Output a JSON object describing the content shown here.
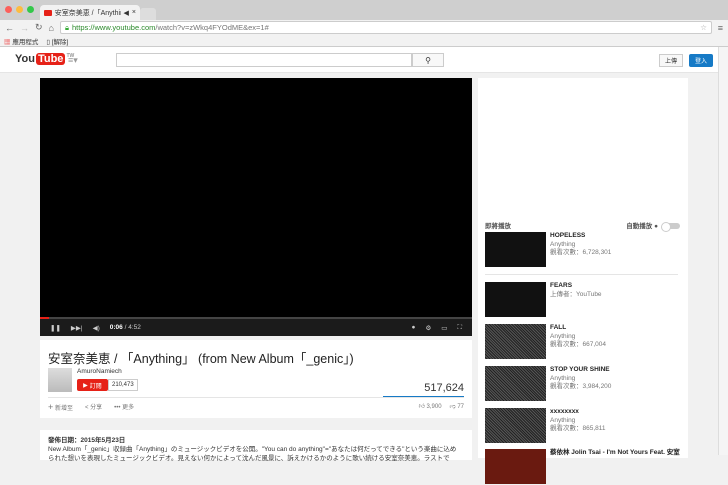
{
  "browser": {
    "tab_title": "安室奈美恵 /「Anything",
    "url_host": "https://www.youtube.com",
    "url_path": "/watch?v=zWkq4FYOdME&ex=1#",
    "bookmarks": [
      "應用程式",
      "[解除]"
    ]
  },
  "header": {
    "logo_you": "You",
    "logo_tube": "Tube",
    "region": "TW",
    "upload": "上傳",
    "signin": "登入"
  },
  "player": {
    "time_current": "0:06",
    "time_total": "/ 4:52",
    "progress_percent": 2
  },
  "video": {
    "title": "安室奈美恵 / 「Anything」 (from New Album「_genic」)",
    "channel": "AmuroNamiech",
    "subscribe": "訂閱",
    "subscribers": "210,473",
    "views": "517,624",
    "add": "新增至",
    "share": "分享",
    "more": "更多",
    "likes": "3,900",
    "dislikes": "77"
  },
  "description": {
    "date": "發佈日期：2015年5月23日",
    "line1": "New Album「_genic」収録曲「Anything」のミュージックビデオを公開。\"You can do anything\"=\"あなたは何だってできる\"という楽曲に込め",
    "line2": "られた想いを表現したミュージックビデオ。見えない何かによって沈んだ風景に、訴えかけるかのように歌い続ける安室奈美恵。ラストで"
  },
  "sidebar": {
    "up_next": "即將播放",
    "autoplay": "自動播放",
    "items": [
      {
        "title": "HOPELESS",
        "line2": "Anything",
        "line3": "觀看次數：6,728,301"
      },
      {
        "title": "FEARS",
        "line2": "上傳者：YouTube",
        "line3": ""
      },
      {
        "title": "FALL",
        "line2": "Anything",
        "line3": "觀看次數：667,004"
      },
      {
        "title": "STOP YOUR SHINE",
        "line2": "Anything",
        "line3": "觀看次數：3,984,200"
      },
      {
        "title": "xxxxxxxx",
        "line2": "Anything",
        "line3": "觀看次數：865,811"
      },
      {
        "title": "蔡依林 Jolin Tsai - I'm Not Yours Feat. 安室",
        "line2": "",
        "line3": ""
      }
    ]
  }
}
